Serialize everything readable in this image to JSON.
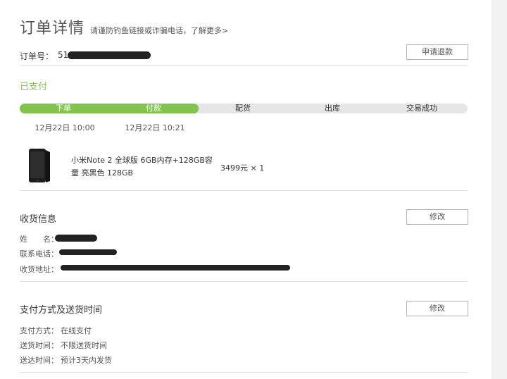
{
  "header": {
    "title": "订单详情",
    "warning": "请谨防钓鱼链接或诈骗电话，",
    "learn_more": "了解更多>"
  },
  "order": {
    "number_label": "订单号：",
    "number_visible": "51",
    "refund_button": "申请退款"
  },
  "status": "已支付",
  "progress": {
    "completed_steps": 2,
    "steps": [
      {
        "label": "下单",
        "time": "12月22日 10:00"
      },
      {
        "label": "付款",
        "time": "12月22日 10:21"
      },
      {
        "label": "配货",
        "time": ""
      },
      {
        "label": "出库",
        "time": ""
      },
      {
        "label": "交易成功",
        "time": ""
      }
    ]
  },
  "product": {
    "name": "小米Note 2 全球版 6GB内存+128GB容量 亮黑色 128GB",
    "price": "3499元 × 1"
  },
  "shipping": {
    "title": "收货信息",
    "edit_button": "修改",
    "name_label": "姓　　名：",
    "phone_label": "联系电话：",
    "address_label": "收货地址："
  },
  "payment": {
    "title": "支付方式及送货时间",
    "edit_button": "修改",
    "rows": [
      {
        "label": "支付方式：",
        "value": "在线支付"
      },
      {
        "label": "送货时间：",
        "value": "不限送货时间"
      },
      {
        "label": "送达时间：",
        "value": "预计3天内发货"
      }
    ]
  },
  "colors": {
    "accent": "#83c44e",
    "track": "#e6e6e6",
    "redaction": "#222222"
  }
}
